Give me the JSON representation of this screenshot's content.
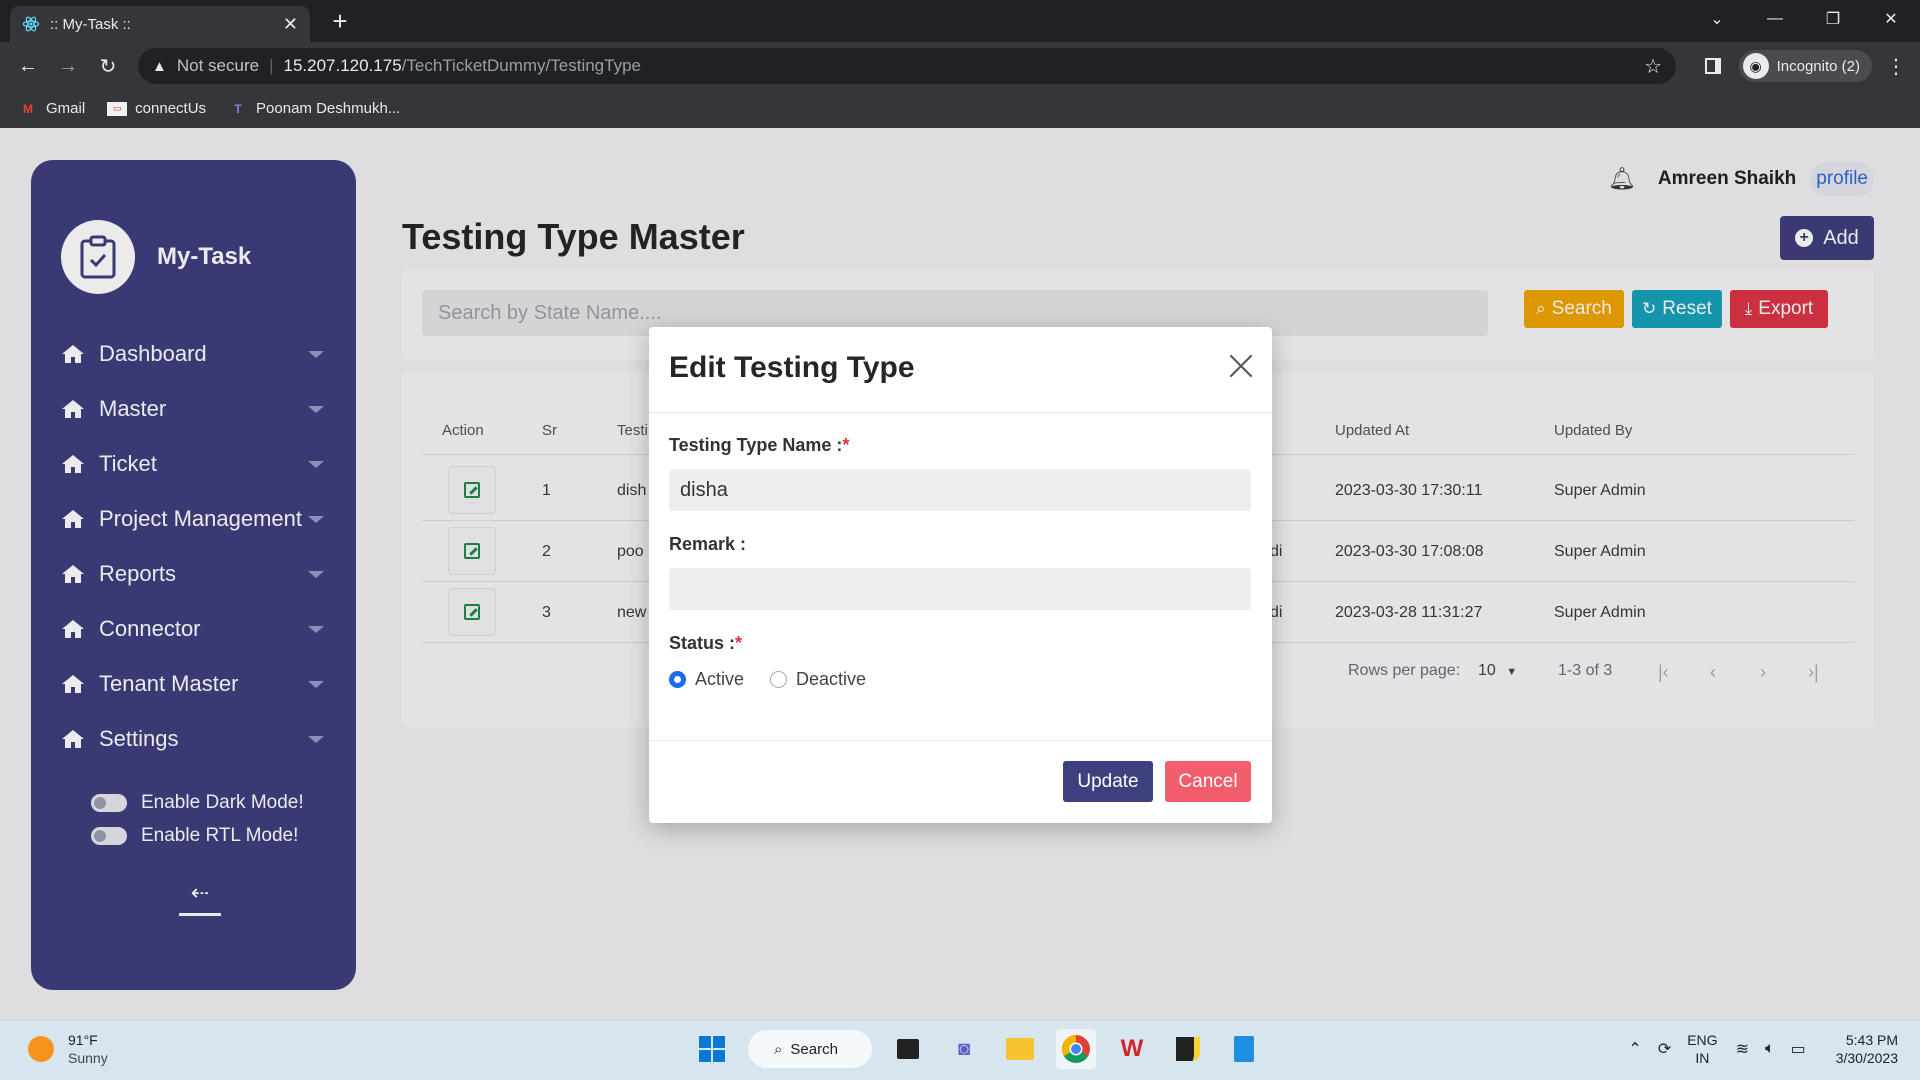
{
  "browser": {
    "tab_title": ":: My-Task ::",
    "url_not_secure": "Not secure",
    "url_host": "15.207.120.175",
    "url_path": "/TechTicketDummy/TestingType",
    "incognito_label": "Incognito (2)",
    "bookmarks": [
      {
        "label": "Gmail",
        "icon": "gmail-icon"
      },
      {
        "label": "connectUs",
        "icon": "folder-icon"
      },
      {
        "label": "Poonam Deshmukh...",
        "icon": "teams-icon"
      }
    ]
  },
  "sidebar": {
    "brand": "My-Task",
    "items": [
      {
        "label": "Dashboard",
        "icon": "home-icon"
      },
      {
        "label": "Master",
        "icon": "home-icon"
      },
      {
        "label": "Ticket",
        "icon": "home-icon"
      },
      {
        "label": "Project Management",
        "icon": "home-icon"
      },
      {
        "label": "Reports",
        "icon": "home-icon"
      },
      {
        "label": "Connector",
        "icon": "home-icon"
      },
      {
        "label": "Tenant Master",
        "icon": "home-icon"
      },
      {
        "label": "Settings",
        "icon": "home-icon"
      }
    ],
    "toggles": [
      {
        "label": "Enable Dark Mode!",
        "on": false
      },
      {
        "label": "Enable RTL Mode!",
        "on": false
      }
    ]
  },
  "header": {
    "user_name": "Amreen Shaikh",
    "profile_alt": "profile"
  },
  "page": {
    "title": "Testing Type Master",
    "add_label": "Add",
    "search_placeholder": "Search by State Name....",
    "search_label": "Search",
    "reset_label": "Reset",
    "export_label": "Export"
  },
  "table": {
    "columns": [
      "Action",
      "Sr",
      "Testi",
      "Updated At",
      "Updated By"
    ],
    "rows": [
      {
        "sr": "1",
        "name": "dish",
        "extra": "",
        "updated_at": "2023-03-30 17:30:11",
        "updated_by": "Super Admin"
      },
      {
        "sr": "2",
        "name": "poo",
        "extra": "di",
        "updated_at": "2023-03-30 17:08:08",
        "updated_by": "Super Admin"
      },
      {
        "sr": "3",
        "name": "new",
        "extra": "di",
        "updated_at": "2023-03-28 11:31:27",
        "updated_by": "Super Admin"
      }
    ],
    "rows_per_page_label": "Rows per page:",
    "rows_per_page_value": "10",
    "range_label": "1-3 of 3"
  },
  "modal": {
    "title": "Edit Testing Type",
    "name_label": "Testing Type Name :",
    "name_value": "disha",
    "remark_label": "Remark :",
    "remark_value": "",
    "status_label": "Status :",
    "status_options": [
      "Active",
      "Deactive"
    ],
    "status_selected": "Active",
    "required_mark": "*",
    "update_label": "Update",
    "cancel_label": "Cancel"
  },
  "taskbar": {
    "temperature": "91°F",
    "condition": "Sunny",
    "search_label": "Search",
    "lang_top": "ENG",
    "lang_bottom": "IN",
    "time": "5:43 PM",
    "date": "3/30/2023"
  },
  "colors": {
    "sidebar": "#3e3f7e",
    "primary": "#3e3f7e",
    "search_btn": "#f0a500",
    "reset_btn": "#17a2b8",
    "export_btn": "#dc3545",
    "cancel_btn": "#f25d6b",
    "radio_checked": "#1c6bef"
  }
}
